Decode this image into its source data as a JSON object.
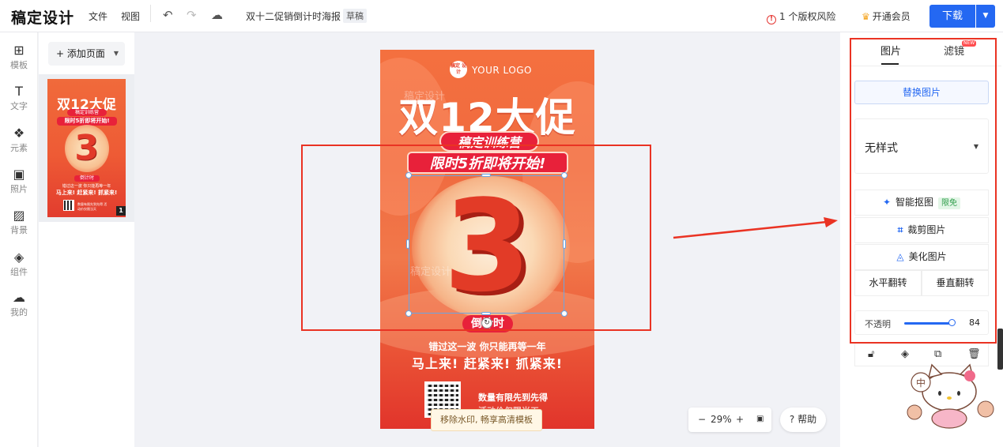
{
  "app": {
    "logo": "稿定设计",
    "menus": [
      "文件",
      "视图"
    ],
    "doc_title": "双十二促销倒计时海报",
    "doc_status": "草稿",
    "risk_count_text": "1 个版权风险",
    "vip_label": "开通会员",
    "download_label": "下载"
  },
  "rail": [
    {
      "icon": "⊞",
      "label": "模板"
    },
    {
      "icon": "T",
      "label": "文字"
    },
    {
      "icon": "❖",
      "label": "元素"
    },
    {
      "icon": "▣",
      "label": "照片"
    },
    {
      "icon": "▨",
      "label": "背景"
    },
    {
      "icon": "◈",
      "label": "组件"
    },
    {
      "icon": "☁",
      "label": "我的"
    }
  ],
  "pages": {
    "add_label": "+ 添加页面",
    "thumb": {
      "title": "双12大促",
      "sub1": "稿定训练营",
      "sub2": "限时5折即将开始!",
      "number": "3",
      "count": "倒计时",
      "line1": "错过这一波 你只能再等一年",
      "line2": "马上来! 赶紧来! 抓紧来!",
      "qr_text": "数量有限先到先得 活动价仅限当天",
      "page_no": "1"
    }
  },
  "poster": {
    "logo_badge": "稿定 设计",
    "your_logo": "YOUR LOGO",
    "title": "双12大促",
    "sub1": "稿定训练营",
    "sub2": "限时5折即将开始!",
    "number": "3",
    "watermark": "稿定设计",
    "count_label": "倒计时",
    "line1": "错过这一波 你只能再等一年",
    "line2": "马上来! 赶紧来! 抓紧来!",
    "qr_text1": "数量有限先到先得",
    "qr_text2": "活动价仅限当天",
    "watermark_banner": "移除水印, 畅享高清模板"
  },
  "zoom": {
    "minus": "−",
    "value": "29%",
    "plus": "+",
    "help": "? 帮助"
  },
  "right_panel": {
    "tabs": [
      "图片",
      "滤镜"
    ],
    "new_badge": "NEW",
    "replace_label": "替换图片",
    "style_value": "无样式",
    "smart_cutout_label": "智能抠图",
    "free_badge": "限免",
    "crop_label": "裁剪图片",
    "beautify_label": "美化图片",
    "flip_h_label": "水平翻转",
    "flip_v_label": "垂直翻转",
    "opacity_label": "不透明",
    "opacity_value": "84",
    "opacity_fraction": 0.84
  },
  "colors": {
    "accent": "#2468f2",
    "annotation": "#ea3323",
    "poster_red": "#e8213a"
  }
}
